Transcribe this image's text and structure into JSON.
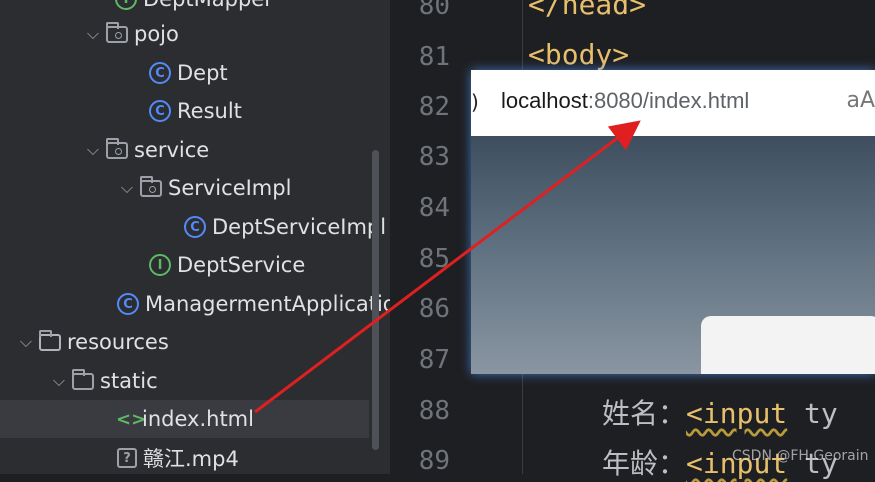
{
  "tree": {
    "items": [
      {
        "label": "DeptMapper",
        "icon": "interface-icon"
      },
      {
        "label": "pojo",
        "icon": "package-folder-icon"
      },
      {
        "label": "Dept",
        "icon": "class-icon"
      },
      {
        "label": "Result",
        "icon": "class-icon"
      },
      {
        "label": "service",
        "icon": "package-folder-icon"
      },
      {
        "label": "ServiceImpl",
        "icon": "package-folder-icon"
      },
      {
        "label": "DeptServiceImpl",
        "icon": "class-icon"
      },
      {
        "label": "DeptService",
        "icon": "interface-icon"
      },
      {
        "label": "ManagermentApplicatio",
        "icon": "spring-app-icon"
      },
      {
        "label": "resources",
        "icon": "resources-folder-icon"
      },
      {
        "label": "static",
        "icon": "folder-icon"
      },
      {
        "label": "index.html",
        "icon": "html-file-icon"
      },
      {
        "label": "赣江.mp4",
        "icon": "unknown-file-icon"
      }
    ],
    "selected": "index.html"
  },
  "editor": {
    "line_numbers": [
      "80",
      "81",
      "82",
      "83",
      "84",
      "85",
      "86",
      "87",
      "88",
      "89"
    ],
    "line80": "</head>",
    "line81": "<body>",
    "line88_text": "姓名：",
    "line88_tag": "<input",
    "line88_attr": " ty",
    "line89_text": "年龄：",
    "line89_tag": "<input",
    "line89_attr": " ty"
  },
  "browser": {
    "url_host": "localhost",
    "url_rest": ":8080/index.html",
    "edge_glyph": ")",
    "reader_icon": "aA"
  },
  "watermark": "CSDN @FH Georain",
  "colors": {
    "accent_blue": "#548af7",
    "interface_green": "#5fb865",
    "arrow_red": "#e02020"
  }
}
